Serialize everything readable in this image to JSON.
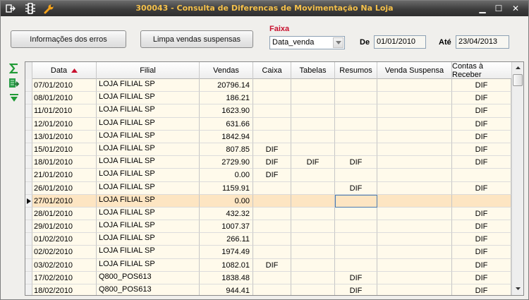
{
  "window": {
    "title": "300043 - Consulta de Diferencas de Movimentação Na Loja",
    "title_color": "#f4c04a",
    "icons": [
      "exit-icon",
      "traffic-light-icon",
      "wrench-icon"
    ],
    "controls": {
      "minimize": "▁",
      "maximize": "☐",
      "close": "✕"
    }
  },
  "toolbar": {
    "error_info_label": "Informações dos erros",
    "clear_suspended_label": "Limpa vendas suspensas",
    "faixa_label": "Faixa",
    "faixa_value": "Data_venda",
    "de_label": "De",
    "de_value": "01/01/2010",
    "ate_label": "Até",
    "ate_value": "23/04/2013"
  },
  "side_icons": [
    "sum-icon",
    "export-icon",
    "expand-down-icon"
  ],
  "grid": {
    "columns": [
      "Data",
      "Filial",
      "Vendas",
      "Caixa",
      "Tabelas",
      "Resumos",
      "Venda Suspensa",
      "Contas à Receber"
    ],
    "sort_column": "Data",
    "sort_direction": "asc",
    "selected_row_index": 9,
    "rows": [
      {
        "data": "07/01/2010",
        "filial": "LOJA FILIAL SP",
        "vendas": "20796.14",
        "caixa": "",
        "tabelas": "",
        "resumos": "",
        "venda_suspensa": "",
        "contas": "DIF"
      },
      {
        "data": "08/01/2010",
        "filial": "LOJA FILIAL SP",
        "vendas": "186.21",
        "caixa": "",
        "tabelas": "",
        "resumos": "",
        "venda_suspensa": "",
        "contas": "DIF"
      },
      {
        "data": "11/01/2010",
        "filial": "LOJA FILIAL SP",
        "vendas": "1623.90",
        "caixa": "",
        "tabelas": "",
        "resumos": "",
        "venda_suspensa": "",
        "contas": "DIF"
      },
      {
        "data": "12/01/2010",
        "filial": "LOJA FILIAL SP",
        "vendas": "631.66",
        "caixa": "",
        "tabelas": "",
        "resumos": "",
        "venda_suspensa": "",
        "contas": "DIF"
      },
      {
        "data": "13/01/2010",
        "filial": "LOJA FILIAL SP",
        "vendas": "1842.94",
        "caixa": "",
        "tabelas": "",
        "resumos": "",
        "venda_suspensa": "",
        "contas": "DIF"
      },
      {
        "data": "15/01/2010",
        "filial": "LOJA FILIAL SP",
        "vendas": "807.85",
        "caixa": "DIF",
        "tabelas": "",
        "resumos": "",
        "venda_suspensa": "",
        "contas": "DIF"
      },
      {
        "data": "18/01/2010",
        "filial": "LOJA FILIAL SP",
        "vendas": "2729.90",
        "caixa": "DIF",
        "tabelas": "DIF",
        "resumos": "DIF",
        "venda_suspensa": "",
        "contas": "DIF"
      },
      {
        "data": "21/01/2010",
        "filial": "LOJA FILIAL SP",
        "vendas": "0.00",
        "caixa": "DIF",
        "tabelas": "",
        "resumos": "",
        "venda_suspensa": "",
        "contas": ""
      },
      {
        "data": "26/01/2010",
        "filial": "LOJA FILIAL SP",
        "vendas": "1159.91",
        "caixa": "",
        "tabelas": "",
        "resumos": "DIF",
        "venda_suspensa": "",
        "contas": "DIF"
      },
      {
        "data": "27/01/2010",
        "filial": "LOJA FILIAL SP",
        "vendas": "0.00",
        "caixa": "",
        "tabelas": "",
        "resumos": "",
        "venda_suspensa": "",
        "contas": ""
      },
      {
        "data": "28/01/2010",
        "filial": "LOJA FILIAL SP",
        "vendas": "432.32",
        "caixa": "",
        "tabelas": "",
        "resumos": "",
        "venda_suspensa": "",
        "contas": "DIF"
      },
      {
        "data": "29/01/2010",
        "filial": "LOJA FILIAL SP",
        "vendas": "1007.37",
        "caixa": "",
        "tabelas": "",
        "resumos": "",
        "venda_suspensa": "",
        "contas": "DIF"
      },
      {
        "data": "01/02/2010",
        "filial": "LOJA FILIAL SP",
        "vendas": "266.11",
        "caixa": "",
        "tabelas": "",
        "resumos": "",
        "venda_suspensa": "",
        "contas": "DIF"
      },
      {
        "data": "02/02/2010",
        "filial": "LOJA FILIAL SP",
        "vendas": "1974.49",
        "caixa": "",
        "tabelas": "",
        "resumos": "",
        "venda_suspensa": "",
        "contas": "DIF"
      },
      {
        "data": "03/02/2010",
        "filial": "LOJA FILIAL SP",
        "vendas": "1082.01",
        "caixa": "DIF",
        "tabelas": "",
        "resumos": "",
        "venda_suspensa": "",
        "contas": "DIF"
      },
      {
        "data": "17/02/2010",
        "filial": "Q800_POS613",
        "vendas": "1838.48",
        "caixa": "",
        "tabelas": "",
        "resumos": "DIF",
        "venda_suspensa": "",
        "contas": "DIF"
      },
      {
        "data": "18/02/2010",
        "filial": "Q800_POS613",
        "vendas": "944.41",
        "caixa": "",
        "tabelas": "",
        "resumos": "DIF",
        "venda_suspensa": "",
        "contas": "DIF"
      }
    ]
  }
}
